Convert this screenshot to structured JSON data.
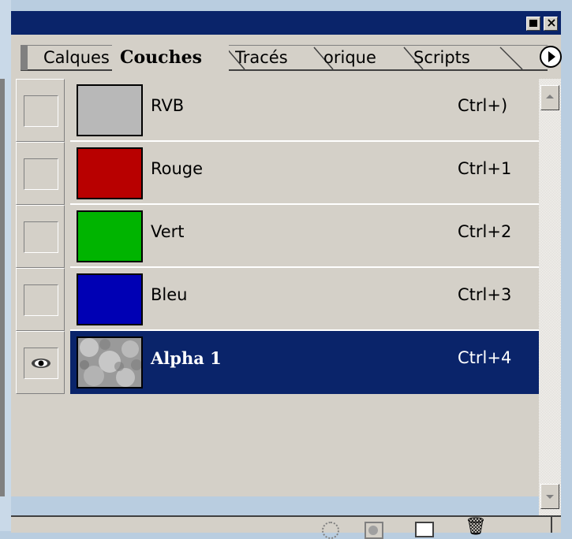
{
  "panel": {
    "tabs": [
      {
        "label": "Calques",
        "active": false
      },
      {
        "label": "Couches",
        "active": true
      },
      {
        "label": "Tracés",
        "active": false
      },
      {
        "label": "orique",
        "active": false
      },
      {
        "label": "Scripts",
        "active": false
      }
    ]
  },
  "channels": [
    {
      "name": "RVB",
      "shortcut": "Ctrl+)",
      "thumb_color": "#b8b8b8",
      "visible": false,
      "selected": false
    },
    {
      "name": "Rouge",
      "shortcut": "Ctrl+1",
      "thumb_color": "#b80000",
      "visible": false,
      "selected": false
    },
    {
      "name": "Vert",
      "shortcut": "Ctrl+2",
      "thumb_color": "#00b400",
      "visible": false,
      "selected": false
    },
    {
      "name": "Bleu",
      "shortcut": "Ctrl+3",
      "thumb_color": "#0000b4",
      "visible": false,
      "selected": false
    },
    {
      "name": "Alpha 1",
      "shortcut": "Ctrl+4",
      "thumb_color": "clouds",
      "visible": true,
      "selected": true
    }
  ],
  "colors": {
    "titlebar": "#0a246a",
    "selection": "#0a246a",
    "panel_bg": "#d4d0c8"
  },
  "icons": {
    "menu": "panel-menu-icon",
    "minimize": "minimize-icon",
    "close": "close-icon",
    "eye": "eye-icon",
    "load_selection": "load-channel-selection-icon",
    "save_selection": "save-selection-as-channel-icon",
    "new_channel": "new-channel-icon",
    "delete": "delete-channel-icon"
  }
}
